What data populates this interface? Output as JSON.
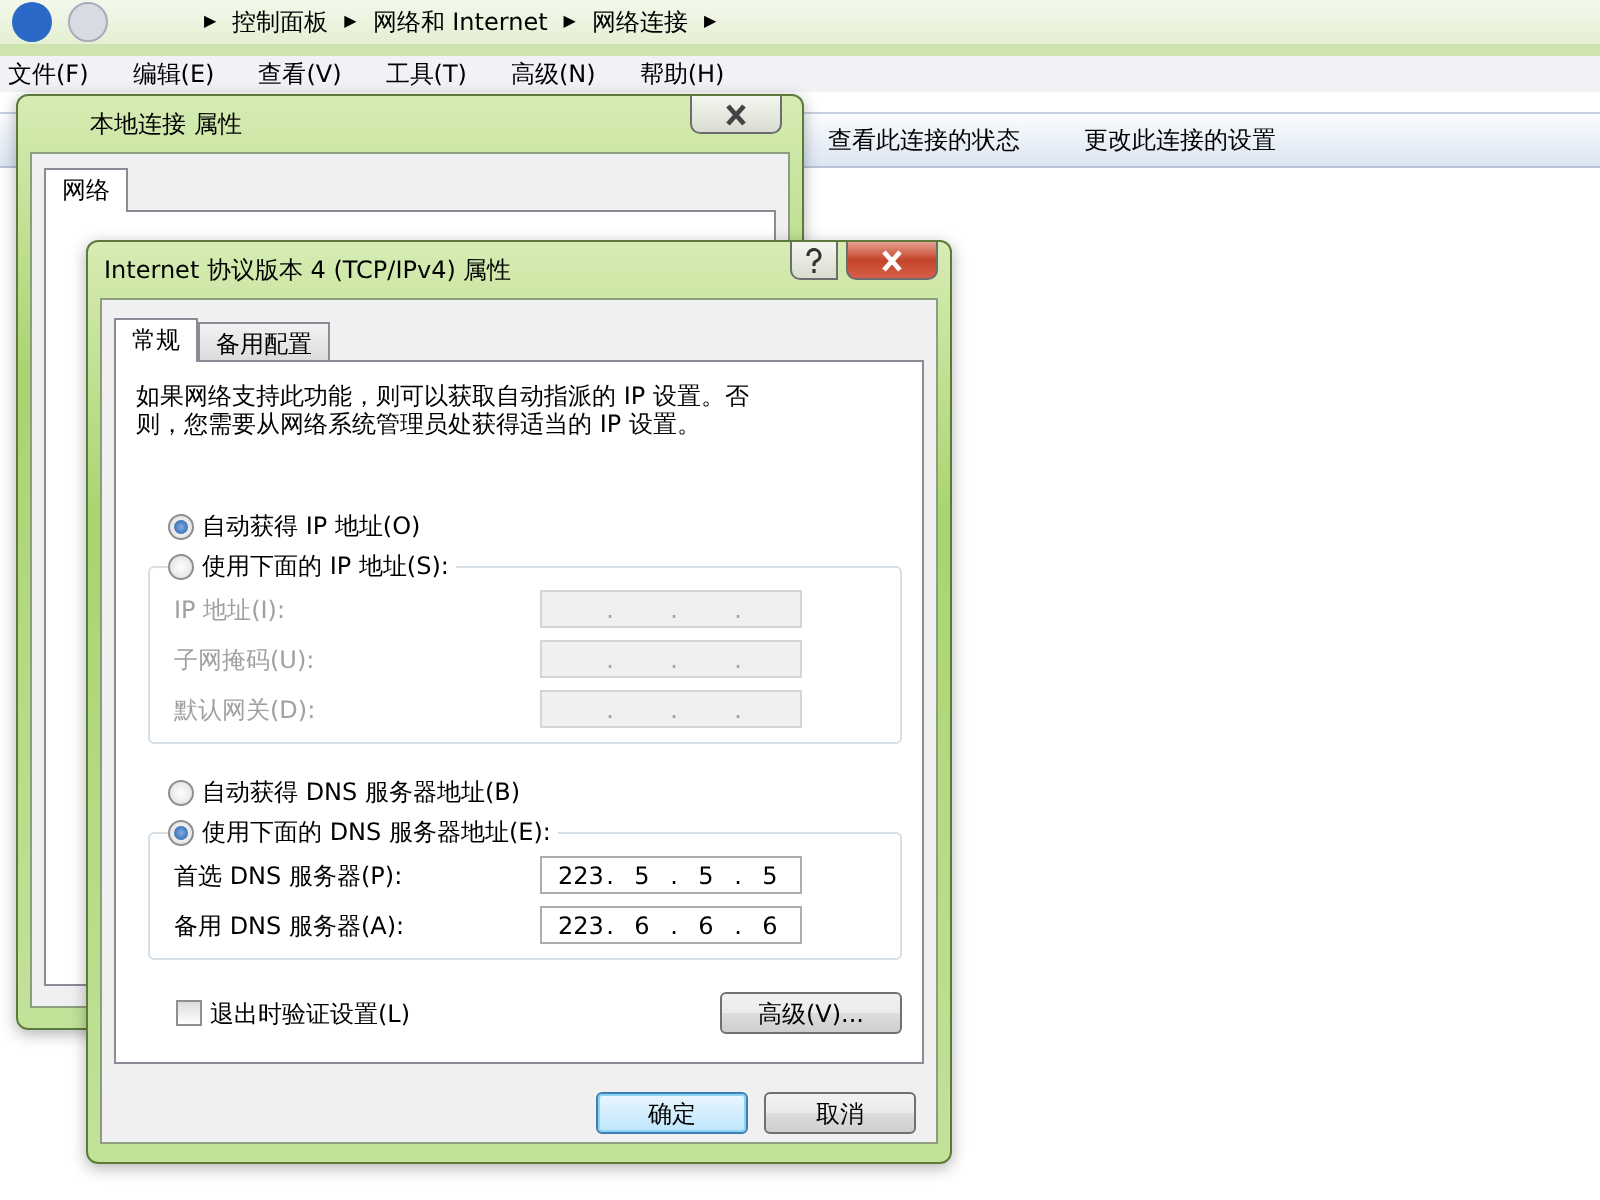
{
  "explorer": {
    "breadcrumb_separator": "▶",
    "breadcrumbs": [
      "控制面板",
      "网络和 Internet",
      "网络连接"
    ],
    "menu": [
      "文件(F)",
      "编辑(E)",
      "查看(V)",
      "工具(T)",
      "高级(N)",
      "帮助(H)"
    ],
    "toolbar": [
      "查看此连接的状态",
      "更改此连接的设置"
    ]
  },
  "back_window": {
    "title": "本地连接 属性",
    "tabs": [
      {
        "label": "网络",
        "selected": true
      }
    ]
  },
  "dialog": {
    "title": "Internet 协议版本 4 (TCP/IPv4) 属性",
    "separator": ".",
    "tabs": [
      {
        "label": "常规",
        "selected": true
      },
      {
        "label": "备用配置",
        "selected": false
      }
    ],
    "description": "如果网络支持此功能，则可以获取自动指派的 IP 设置。否则，您需要从网络系统管理员处获得适当的 IP 设置。",
    "ip_options": [
      {
        "label": "自动获得 IP 地址(O)",
        "selected": true
      },
      {
        "label": "使用下面的 IP 地址(S):",
        "selected": false
      }
    ],
    "ip_fields": [
      {
        "label": "IP 地址(I):",
        "disabled": true
      },
      {
        "label": "子网掩码(U):",
        "disabled": true
      },
      {
        "label": "默认网关(D):",
        "disabled": true
      }
    ],
    "dns_options": [
      {
        "label": "自动获得 DNS 服务器地址(B)",
        "selected": false
      },
      {
        "label": "使用下面的 DNS 服务器地址(E):",
        "selected": true
      }
    ],
    "dns_fields": [
      {
        "label": "首选 DNS 服务器(P):",
        "disabled": false,
        "octets": [
          "223",
          "5",
          "5",
          "5"
        ]
      },
      {
        "label": "备用 DNS 服务器(A):",
        "disabled": false,
        "octets": [
          "223",
          "6",
          "6",
          "6"
        ]
      }
    ],
    "validate_checkbox": {
      "label": "退出时验证设置(L)",
      "checked": false
    },
    "advanced_button": "高级(V)...",
    "buttons": [
      {
        "label": "确定",
        "default": true
      },
      {
        "label": "取消",
        "default": false
      }
    ]
  }
}
